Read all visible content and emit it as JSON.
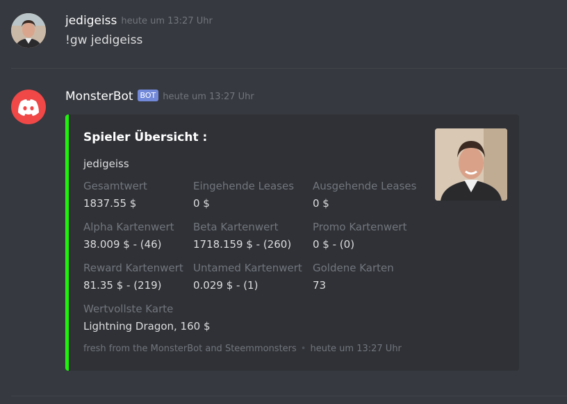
{
  "messages": [
    {
      "author": "jedigeiss",
      "timestamp": "heute um 13:27 Uhr",
      "content": "!gw jedigeiss"
    },
    {
      "author": "MonsterBot",
      "badge": "BOT",
      "timestamp": "heute um 13:27 Uhr",
      "embed": {
        "accent_color": "#1ff30b",
        "title": "Spieler Übersicht :",
        "description": "jedigeiss",
        "fields": [
          {
            "name": "Gesamtwert",
            "value": "1837.55 $"
          },
          {
            "name": "Eingehende Leases",
            "value": "0 $"
          },
          {
            "name": "Ausgehende Leases",
            "value": "0 $"
          },
          {
            "name": "Alpha Kartenwert",
            "value": "38.009 $ - (46)"
          },
          {
            "name": "Beta Kartenwert",
            "value": "1718.159 $ - (260)"
          },
          {
            "name": "Promo Kartenwert",
            "value": "0 $ - (0)"
          },
          {
            "name": "Reward Kartenwert",
            "value": "81.35 $ - (219)"
          },
          {
            "name": "Untamed Kartenwert",
            "value": "0.029 $ - (1)"
          },
          {
            "name": "Goldene Karten",
            "value": "73"
          },
          {
            "name": "Wertvollste Karte",
            "value": "Lightning Dragon, 160 $"
          }
        ],
        "footer": "fresh from the MonsterBot and Steemmonsters",
        "footer_timestamp": "heute um 13:27 Uhr"
      }
    }
  ],
  "colors": {
    "background": "#36393f",
    "embed_background": "#2f3136",
    "discord_logo": "#f04747",
    "bot_badge": "#7289da"
  }
}
